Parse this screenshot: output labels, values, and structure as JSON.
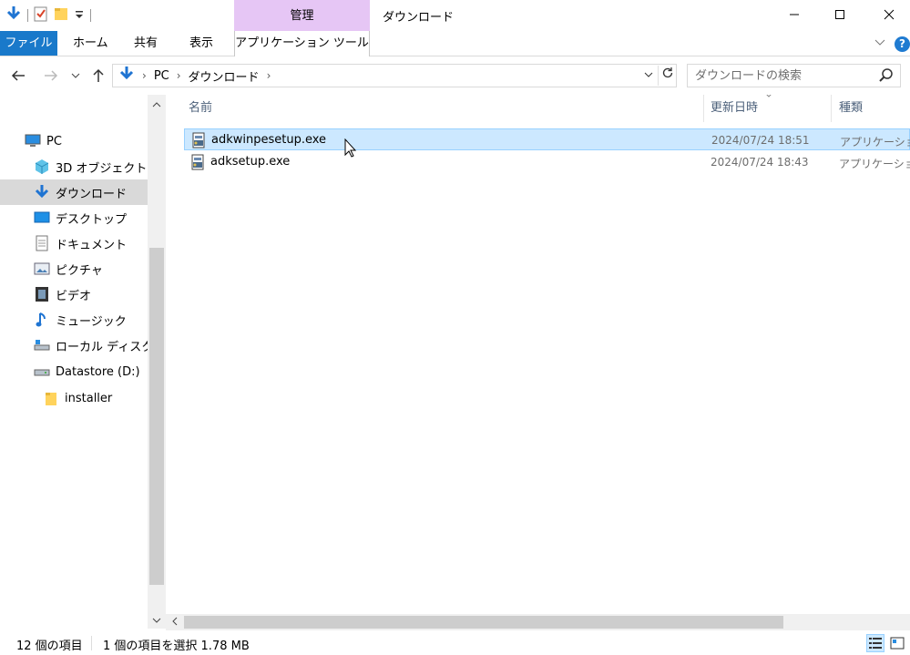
{
  "window": {
    "title": "ダウンロード",
    "manage_label": "管理",
    "minimize_icon": "minimize-icon",
    "maximize_icon": "maximize-icon",
    "close_icon": "close-icon"
  },
  "ribbon": {
    "file_label": "ファイル",
    "tabs": [
      "ホーム",
      "共有",
      "表示"
    ],
    "app_tools_label": "アプリケーション ツール",
    "accent_color": "#1979ca",
    "manage_color": "#e6c6f5"
  },
  "address": {
    "crumbs": [
      "PC",
      "ダウンロード"
    ]
  },
  "search": {
    "placeholder": "ダウンロードの検索"
  },
  "sidebar": {
    "items": [
      {
        "label": "PC",
        "icon": "computer-icon"
      },
      {
        "label": "3D オブジェクト",
        "icon": "3d-objects-icon"
      },
      {
        "label": "ダウンロード",
        "icon": "download-icon",
        "selected": true
      },
      {
        "label": "デスクトップ",
        "icon": "desktop-icon"
      },
      {
        "label": "ドキュメント",
        "icon": "documents-icon"
      },
      {
        "label": "ピクチャ",
        "icon": "pictures-icon"
      },
      {
        "label": "ビデオ",
        "icon": "videos-icon"
      },
      {
        "label": "ミュージック",
        "icon": "music-icon"
      },
      {
        "label": "ローカル ディスク (C",
        "icon": "local-disk-icon"
      },
      {
        "label": "Datastore (D:)",
        "icon": "drive-icon"
      },
      {
        "label": "installer",
        "icon": "folder-icon"
      }
    ]
  },
  "columns": {
    "name": "名前",
    "modified": "更新日時",
    "type": "種類"
  },
  "files": [
    {
      "name": "adkwinpesetup.exe",
      "modified": "2024/07/24 18:51",
      "type": "アプリケーション",
      "selected": true
    },
    {
      "name": "adksetup.exe",
      "modified": "2024/07/24 18:43",
      "type": "アプリケーション",
      "selected": false
    }
  ],
  "status": {
    "item_count": "12 個の項目",
    "selection": "1 個の項目を選択  1.78 MB"
  }
}
